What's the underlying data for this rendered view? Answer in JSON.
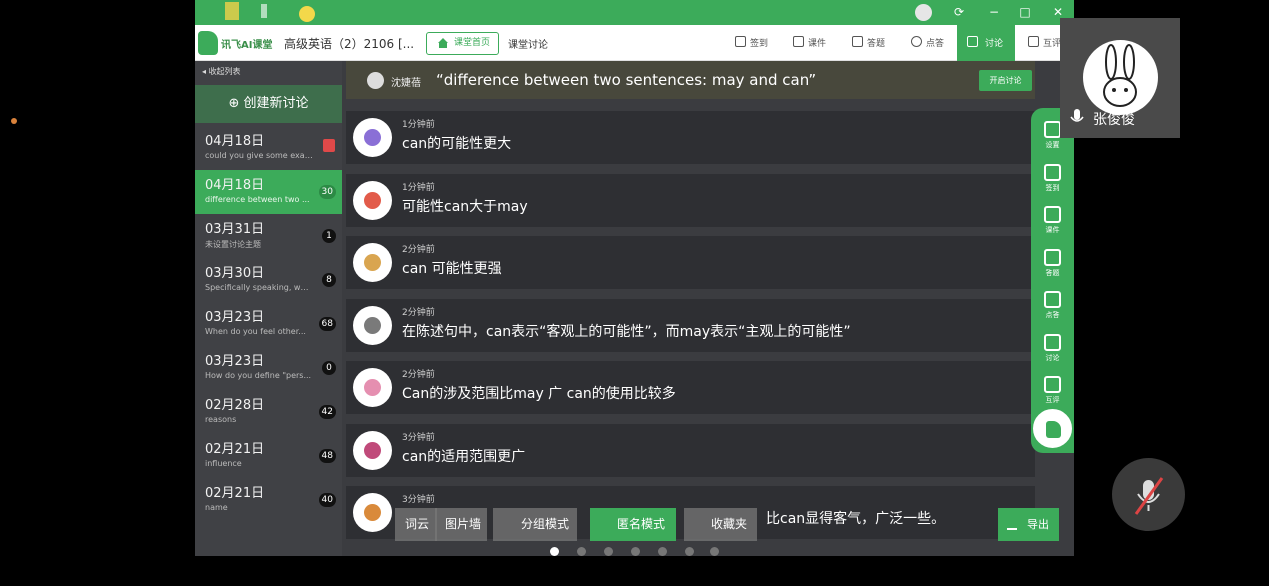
{
  "toolbar": {
    "logo_text": "讯飞AI课堂",
    "course": "高级英语（2）2106 [...",
    "home_label": "课堂首页",
    "discussion_tab": "课堂讨论",
    "items": [
      {
        "label": "签到",
        "icon": "calendar-icon"
      },
      {
        "label": "课件",
        "icon": "play-icon"
      },
      {
        "label": "答题",
        "icon": "quiz-icon"
      },
      {
        "label": "点答",
        "icon": "check-icon"
      }
    ],
    "active_item": "讨论",
    "last_item": "互评"
  },
  "sidebar": {
    "collapse_label": "收起列表",
    "create_label": "创建新讨论",
    "items": [
      {
        "date": "04月18日",
        "subtitle": "could you give some exam...",
        "count": ""
      },
      {
        "date": "04月18日",
        "subtitle": "difference between two ...",
        "count": "30"
      },
      {
        "date": "03月31日",
        "subtitle": "未设置讨论主题",
        "count": "1"
      },
      {
        "date": "03月30日",
        "subtitle": "Specifically speaking, wha...",
        "count": "8"
      },
      {
        "date": "03月23日",
        "subtitle": "When do you feel other...",
        "count": "68"
      },
      {
        "date": "03月23日",
        "subtitle": "How do you define \"pers...",
        "count": "0"
      },
      {
        "date": "02月28日",
        "subtitle": "reasons",
        "count": "42"
      },
      {
        "date": "02月21日",
        "subtitle": "influence",
        "count": "48"
      },
      {
        "date": "02月21日",
        "subtitle": "name",
        "count": "40"
      }
    ]
  },
  "question": {
    "author": "沈婕蓓",
    "text": "“difference between two sentences: may and can”",
    "start_label": "开启讨论"
  },
  "messages": [
    {
      "time": "1分钟前",
      "text": "can的可能性更大",
      "color": "#8a6fd6"
    },
    {
      "time": "1分钟前",
      "text": "可能性can大于may",
      "color": "#e25b4a"
    },
    {
      "time": "2分钟前",
      "text": "can 可能性更强",
      "color": "#d9a550"
    },
    {
      "time": "2分钟前",
      "text": "在陈述句中，can表示“客观上的可能性”，而may表示“主观上的可能性”",
      "color": "#7a7a7a"
    },
    {
      "time": "2分钟前",
      "text": "Can的涉及范围比may 广 can的使用比较多",
      "color": "#e58fb0"
    },
    {
      "time": "3分钟前",
      "text": "can的适用范围更广",
      "color": "#c04a7a"
    },
    {
      "time": "3分钟前",
      "text": "比can显得客气，广泛一些。",
      "color": "#d98a3b"
    }
  ],
  "rail": [
    {
      "label": "设置",
      "icon": "bookmark-icon"
    },
    {
      "label": "签到",
      "icon": "calendar-icon"
    },
    {
      "label": "课件",
      "icon": "play-icon"
    },
    {
      "label": "答题",
      "icon": "quiz-icon"
    },
    {
      "label": "点答",
      "icon": "check-icon"
    },
    {
      "label": "讨论",
      "icon": "people-icon"
    },
    {
      "label": "互评",
      "icon": "chart-icon"
    }
  ],
  "bottom": {
    "wordcloud": "词云",
    "picwall": "图片墙",
    "group_mode": "分组模式",
    "anon_mode": "匿名模式",
    "favorites": "收藏夹",
    "export": "导出"
  },
  "video": {
    "name": "张俊俊"
  }
}
